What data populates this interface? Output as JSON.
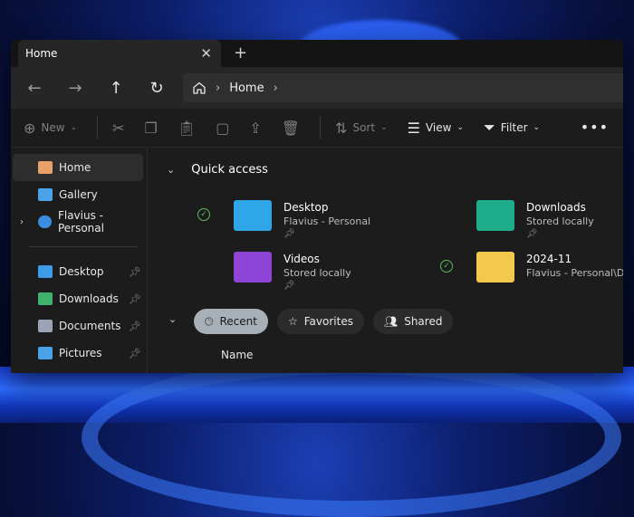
{
  "tabs": [
    {
      "label": "Home"
    }
  ],
  "navigation": {
    "breadcrumb": [
      "Home"
    ]
  },
  "toolbar": {
    "new_label": "New",
    "sort_label": "Sort",
    "view_label": "View",
    "filter_label": "Filter"
  },
  "sidebar": {
    "top": [
      {
        "label": "Home",
        "icon": "home-icon",
        "color": "#e8a16a"
      },
      {
        "label": "Gallery",
        "icon": "gallery-icon",
        "color": "#4aa3e8"
      },
      {
        "label": "Flavius - Personal",
        "icon": "cloud-icon",
        "color": "#3b8de0"
      }
    ],
    "pinned": [
      {
        "label": "Desktop",
        "icon": "desktop-icon",
        "color": "#3d9be8"
      },
      {
        "label": "Downloads",
        "icon": "download-icon",
        "color": "#3fb26b"
      },
      {
        "label": "Documents",
        "icon": "documents-icon",
        "color": "#9aa4b2"
      },
      {
        "label": "Pictures",
        "icon": "pictures-icon",
        "color": "#4aa3e8"
      }
    ]
  },
  "quick_access": {
    "title": "Quick access",
    "items": [
      {
        "name": "Desktop",
        "sub": "Flavius - Personal",
        "color": "#2ea6e8",
        "synced": true
      },
      {
        "name": "Downloads",
        "sub": "Stored locally",
        "color": "#1fae8c",
        "synced": false
      },
      {
        "name": "Videos",
        "sub": "Stored locally",
        "color": "#8e44d6",
        "synced": false
      },
      {
        "name": "2024-11",
        "sub": "Flavius - Personal\\D...",
        "color": "#f2c94c",
        "synced": true
      }
    ]
  },
  "filters": [
    {
      "label": "Recent",
      "selected": true
    },
    {
      "label": "Favorites",
      "selected": false
    },
    {
      "label": "Shared",
      "selected": false
    }
  ],
  "list": {
    "columns": [
      "Name"
    ]
  }
}
